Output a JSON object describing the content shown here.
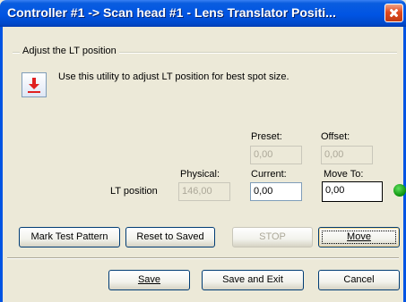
{
  "window": {
    "title": "Controller #1 -> Scan head #1 - Lens Translator Positi..."
  },
  "group": {
    "legend": "Adjust the LT position",
    "description": "Use this utility to adjust LT position for best spot size."
  },
  "labels": {
    "preset": "Preset:",
    "offset": "Offset:",
    "physical": "Physical:",
    "current": "Current:",
    "move_to": "Move To:",
    "lt_position": "LT position"
  },
  "fields": {
    "preset_value": "0,00",
    "offset_value": "0,00",
    "physical_value": "146,00",
    "current_value": "0,00",
    "move_to_value": "0,00"
  },
  "status": {
    "led_color": "#0a8f0a"
  },
  "buttons": {
    "mark_test_pattern": "Mark Test Pattern",
    "reset_to_saved": "Reset to Saved",
    "stop": "STOP",
    "move": "Move",
    "save": "Save",
    "save_and_exit": "Save and Exit",
    "cancel": "Cancel"
  }
}
